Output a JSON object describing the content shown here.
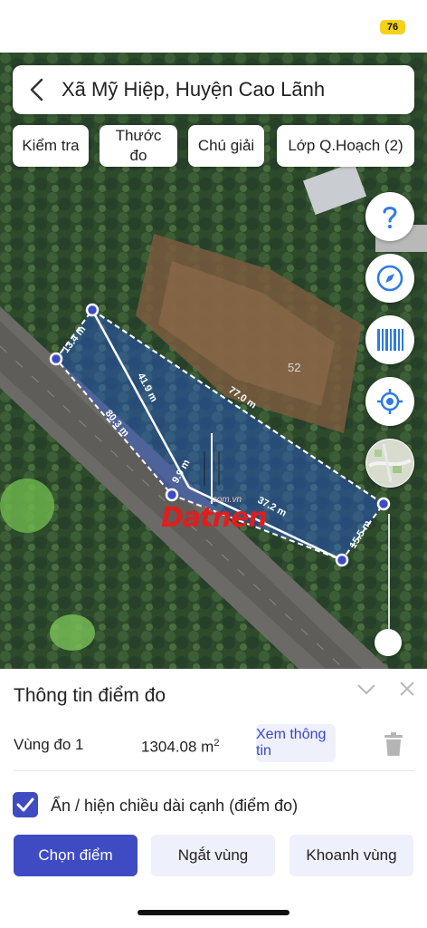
{
  "status": {
    "battery": "76"
  },
  "header": {
    "title": "Xã Mỹ Hiệp, Huyện Cao Lãnh"
  },
  "chips": [
    {
      "label": "Kiểm tra"
    },
    {
      "label_line1": "Thước",
      "label_line2": "đo"
    },
    {
      "label": "Chú giải"
    },
    {
      "label": "Lớp Q.Hoạch (2)"
    }
  ],
  "fabs": [
    "help-icon",
    "compass-icon",
    "barcode-icon",
    "locate-icon",
    "map-layer-icon"
  ],
  "map": {
    "edge_labels": [
      "13.4 m",
      "41.9 m",
      "77.0 m",
      "80.3 m",
      "9.9 m",
      "37.2 m",
      "15.5 m"
    ],
    "parcel_number": "52",
    "watermark": "Datnen",
    "watermark_sub": ".com.vn"
  },
  "panel": {
    "title": "Thông tin điểm đo",
    "area_name": "Vùng đo 1",
    "area_value": "1304.08 m",
    "area_unit_sup": "2",
    "info_button": "Xem thông tin",
    "checkbox_label": "Ẩn / hiện chiều dài cạnh (điểm đo)",
    "checkbox_checked": true,
    "buttons": {
      "select_point": "Chọn điểm",
      "break_region": "Ngắt vùng",
      "enclose_region": "Khoanh vùng"
    }
  },
  "colors": {
    "accent": "#3f4bc2",
    "accent_light": "#eef0fb",
    "polygon_fill": "#2a5bd6",
    "watermark": "#e01e1e"
  }
}
